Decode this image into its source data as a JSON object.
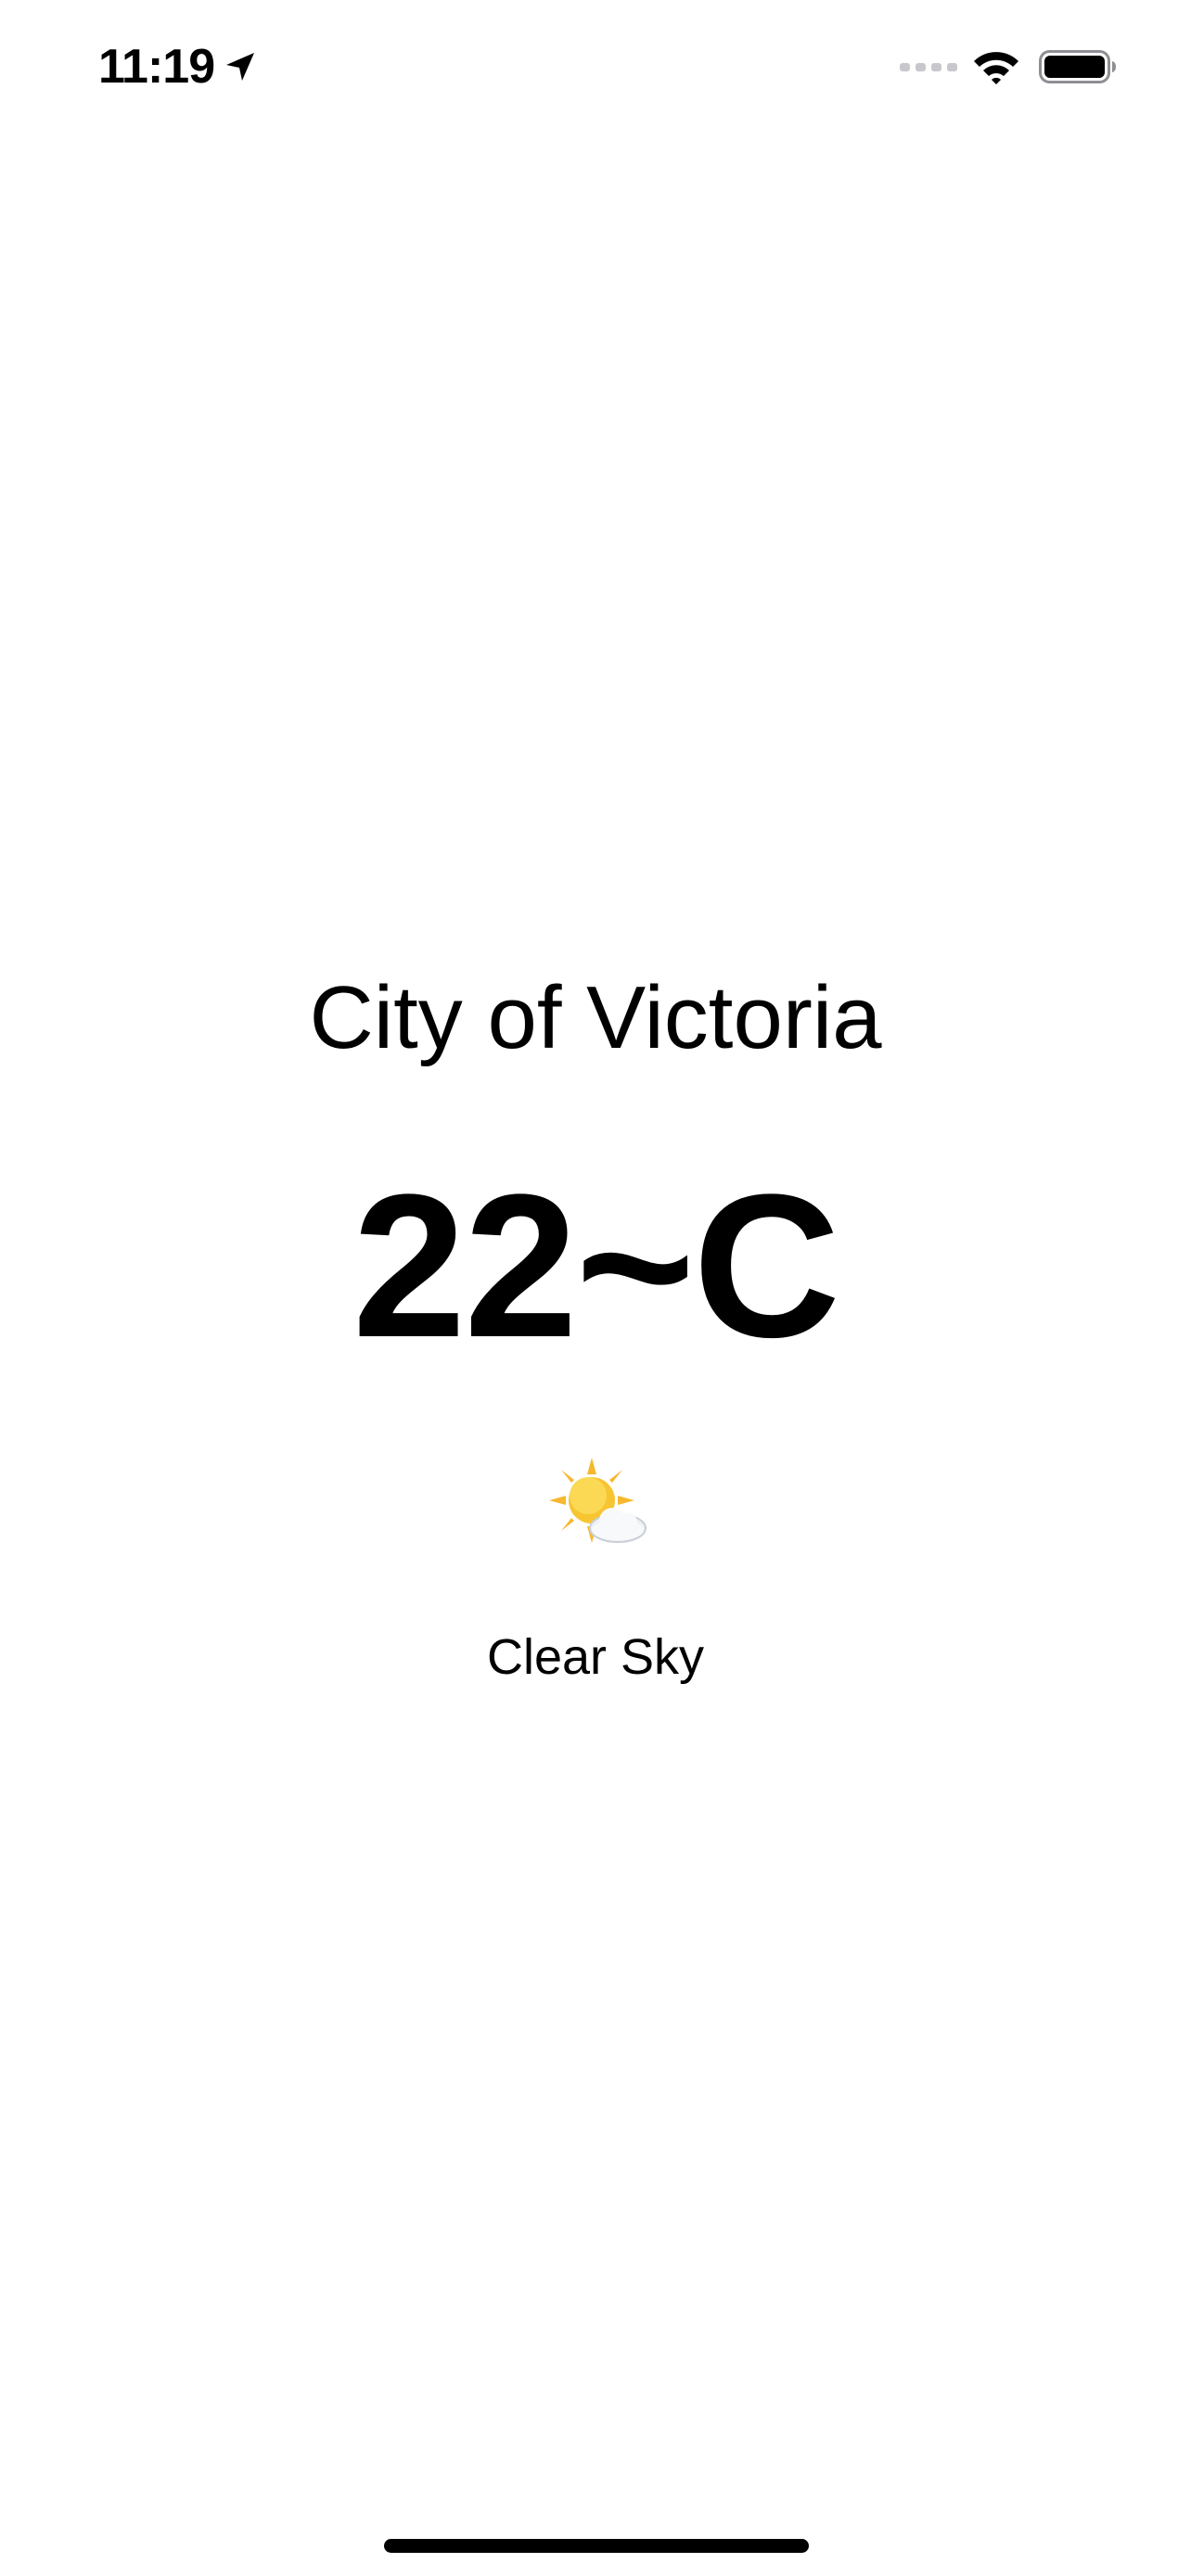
{
  "status_bar": {
    "time": "11:19",
    "location_icon": "location-arrow-icon",
    "signal_icon": "cellular-signal-icon",
    "wifi_icon": "wifi-icon",
    "battery_icon": "battery-icon"
  },
  "weather": {
    "city": "City of Victoria",
    "temperature": "22~C",
    "icon": "sun-behind-cloud-icon",
    "condition": "Clear Sky"
  },
  "colors": {
    "background": "#ffffff",
    "text": "#000000",
    "signal_inactive": "#c7c7cc",
    "sun": "#f7c531",
    "cloud": "#eef1f5"
  }
}
